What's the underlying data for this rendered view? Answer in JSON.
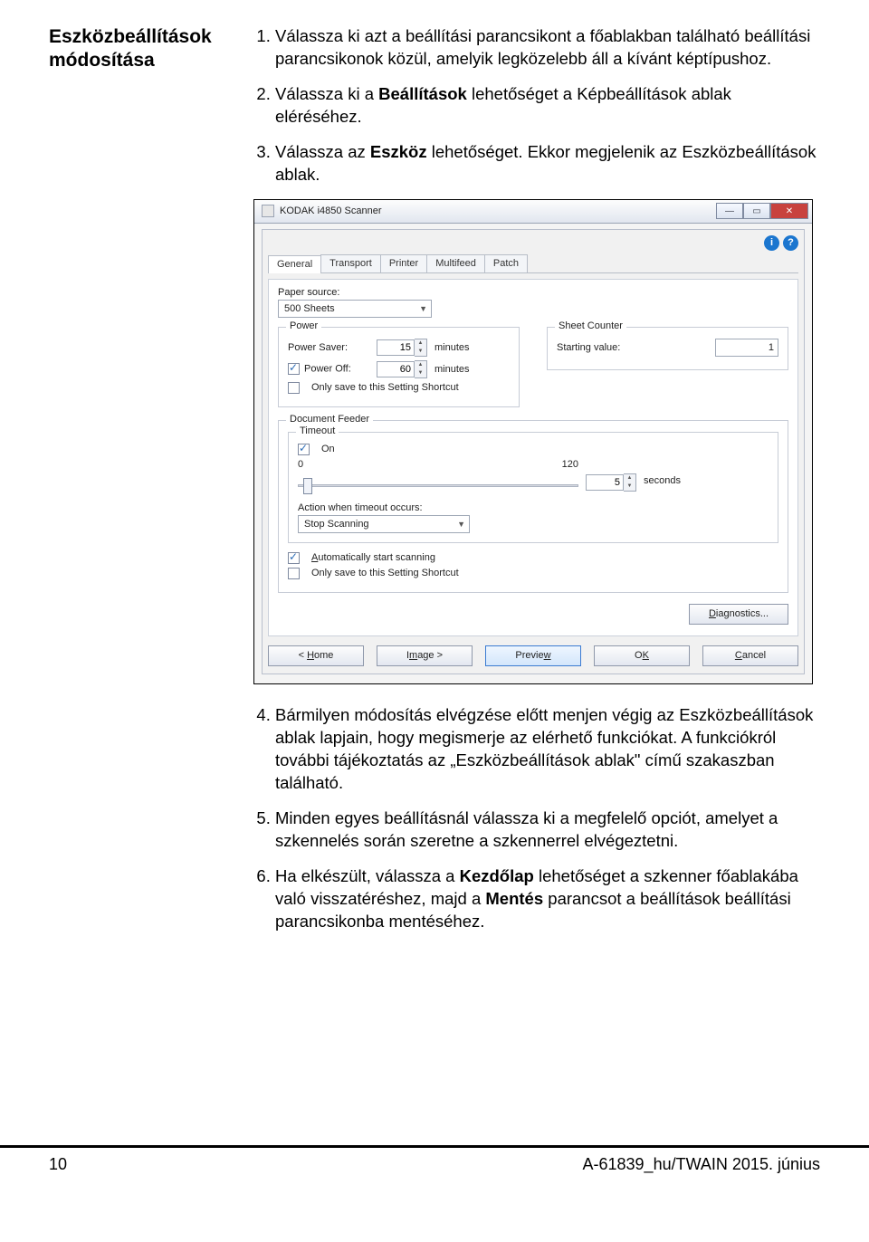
{
  "section_title_1": "Eszközbeállítások",
  "section_title_2": "módosítása",
  "steps": {
    "s1": "Válassza ki azt a beállítási parancsikont a főablakban található beállítási parancsikonok közül, amelyik legközelebb áll a kívánt képtípushoz.",
    "s2a": "Válassza ki a ",
    "s2b": "Beállítások",
    "s2c": " lehetőséget a Képbeállítások ablak eléréséhez.",
    "s3a": "Válassza az ",
    "s3b": "Eszköz",
    "s3c": " lehetőséget. Ekkor megjelenik az Eszközbeállítások ablak.",
    "s4": "Bármilyen módosítás elvégzése előtt menjen végig az Eszközbeállítások ablak lapjain, hogy megismerje az elérhető funkciókat. A funkciókról további tájékoztatás az „Eszközbeállítások ablak\" című szakaszban található.",
    "s5": "Minden egyes beállításnál válassza ki a megfelelő opciót, amelyet a szkennelés során szeretne a szkennerrel elvégeztetni.",
    "s6a": "Ha elkészült, válassza a ",
    "s6b": "Kezdőlap",
    "s6c": " lehetőséget a szkenner főablakába való visszatéréshez, majd a ",
    "s6d": "Mentés",
    "s6e": " parancsot a beállítások beállítási parancsikonba mentéséhez."
  },
  "ss": {
    "title": "KODAK i4850 Scanner",
    "tabs": [
      "General",
      "Transport",
      "Printer",
      "Multifeed",
      "Patch"
    ],
    "paper_source_label": "Paper source:",
    "paper_source_value": "500 Sheets",
    "power_group": "Power",
    "power_saver": "Power Saver:",
    "power_saver_val": "15",
    "power_off": "Power Off:",
    "power_off_val": "60",
    "minutes": "minutes",
    "only_save": "Only save to this Setting Shortcut",
    "sheet_counter": "Sheet Counter",
    "starting_value": "Starting value:",
    "starting_value_val": "1",
    "doc_feeder": "Document Feeder",
    "timeout": "Timeout",
    "on": "On",
    "slider_min": "0",
    "slider_max": "120",
    "slider_val": "5",
    "seconds": "seconds",
    "action_label": "Action when timeout occurs:",
    "action_value": "Stop Scanning",
    "auto_start": "Automatically start scanning",
    "diagnostics": "Diagnostics...",
    "btn_home": "< Home",
    "btn_image": "Image >",
    "btn_preview": "Preview",
    "btn_ok": "OK",
    "btn_cancel": "Cancel"
  },
  "footer": {
    "page": "10",
    "docid": "A-61839_hu/TWAIN  2015. június"
  }
}
